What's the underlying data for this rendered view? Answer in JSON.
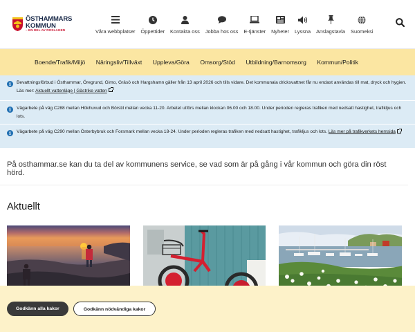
{
  "logo": {
    "line1": "ÖSTHAMMARS",
    "line2": "KOMMUN",
    "tagline": "– EN DEL AV ROSLAGEN"
  },
  "toplinks": [
    {
      "label": "Våra webbplatser",
      "icon": "menu-icon"
    },
    {
      "label": "Öppettider",
      "icon": "clock-icon"
    },
    {
      "label": "Kontakta oss",
      "icon": "person-icon"
    },
    {
      "label": "Jobba hos oss",
      "icon": "chat-icon"
    },
    {
      "label": "E-tjänster",
      "icon": "laptop-icon"
    },
    {
      "label": "Nyheter",
      "icon": "newspaper-icon"
    },
    {
      "label": "Lyssna",
      "icon": "speaker-icon"
    },
    {
      "label": "Anslagstavla",
      "icon": "pin-icon"
    },
    {
      "label": "Suomeksi",
      "icon": "globe-icon"
    }
  ],
  "search_icon": "search-icon",
  "mainnav": [
    "Boende/Trafik/Miljö",
    "Näringsliv/Tillväxt",
    "Uppleva/Göra",
    "Omsorg/Stöd",
    "Utbildning/Barnomsorg",
    "Kommun/Politik"
  ],
  "alerts": [
    {
      "text": "Bevattningsförbud i Östhammar, Öregrund, Gimo, Gräsö och Hargshamn  gäller från 13 april 2026 och tills vidare. Det kommunala dricksvattnet får nu endast användas till mat, dryck och hygien. Läs mer: ",
      "link": "Aktuellt vattenläge | Gästrike vatten"
    },
    {
      "text": "Vägarbete på väg C288 mellan Hökhuvud och Börstil mellan vecka 11-20. Arbetet utförs mellan klockan 06.00 och 18.00. Under perioden regleras trafiken med nedsatt hastighet, trafikljus och lots.",
      "link": ""
    },
    {
      "text": "Vägarbete på väg C290 mellan Österbybruk och Forsmark mellan vecka 18-24. Under perioden regleras trafiken med nedsatt hastighet, trafikljus och lots. ",
      "link": "Läs mer på trafikverkets hemsida"
    }
  ],
  "intro": "På osthammar.se kan du ta del av kommunens service, se vad som är på gång i vår kommun och göra din röst hörd.",
  "section_title": "Aktuellt",
  "cookie": {
    "accept_all": "Godkänn alla kakor",
    "accept_necessary": "Godkänn nödvändiga kakor"
  }
}
